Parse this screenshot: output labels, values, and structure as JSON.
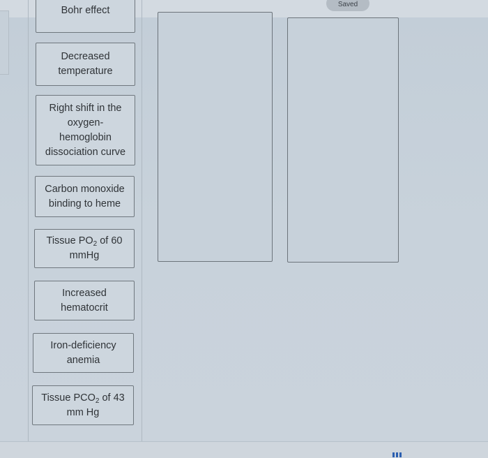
{
  "status": {
    "saved_label": "Saved"
  },
  "tiles": [
    {
      "id": "bohr-effect",
      "label": "Bohr effect"
    },
    {
      "id": "decreased-temperature",
      "label": "Decreased temperature"
    },
    {
      "id": "right-shift",
      "label": "Right shift in the oxygen-hemoglobin dissociation curve"
    },
    {
      "id": "carbon-monoxide",
      "label": "Carbon monoxide binding to heme"
    },
    {
      "id": "tissue-po2",
      "label_pre": "Tissue PO",
      "label_sub": "2",
      "label_post": " of 60 mmHg"
    },
    {
      "id": "increased-hematocrit",
      "label": "Increased hematocrit"
    },
    {
      "id": "iron-deficiency",
      "label": "Iron-deficiency anemia"
    },
    {
      "id": "tissue-pco2",
      "label_pre": "Tissue PCO",
      "label_sub": "2",
      "label_post": " of 43 mm Hg"
    }
  ],
  "drop_zones": [
    {
      "id": "zone-1",
      "label": ""
    },
    {
      "id": "zone-2",
      "label": ""
    }
  ],
  "dock": {
    "icon": "grid-icon"
  }
}
